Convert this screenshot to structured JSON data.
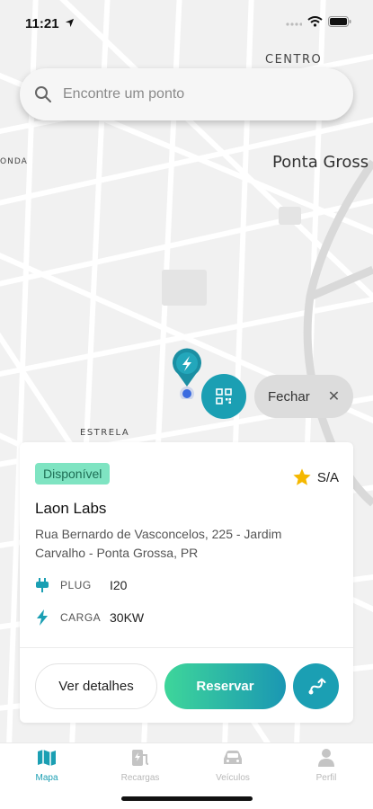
{
  "status_bar": {
    "time": "11:21"
  },
  "search": {
    "placeholder": "Encontre um ponto"
  },
  "map": {
    "labels": {
      "centro": "CENTRO",
      "city": "Ponta Gross",
      "onda": "ONDA",
      "estrela": "ESTRELA"
    }
  },
  "close_chip": {
    "label": "Fechar",
    "close_glyph": "✕"
  },
  "station": {
    "status": "Disponível",
    "rating": "S/A",
    "name": "Laon Labs",
    "address": "Rua Bernardo de Vasconcelos, 225 - Jardim Carvalho - Ponta Grossa, PR",
    "plug_label": "PLUG",
    "plug_value": "I20",
    "charge_label": "CARGA",
    "charge_value": "30KW"
  },
  "actions": {
    "details": "Ver detalhes",
    "reserve": "Reservar"
  },
  "tabs": [
    {
      "label": "Mapa",
      "icon": "map-icon",
      "active": true
    },
    {
      "label": "Recargas",
      "icon": "charging-station-icon",
      "active": false
    },
    {
      "label": "Veículos",
      "icon": "car-icon",
      "active": false
    },
    {
      "label": "Perfil",
      "icon": "person-icon",
      "active": false
    }
  ],
  "colors": {
    "accent": "#1b9fb3",
    "badge_bg": "#7fe4c2",
    "gradient_start": "#3ed69a",
    "star": "#f5b800"
  }
}
